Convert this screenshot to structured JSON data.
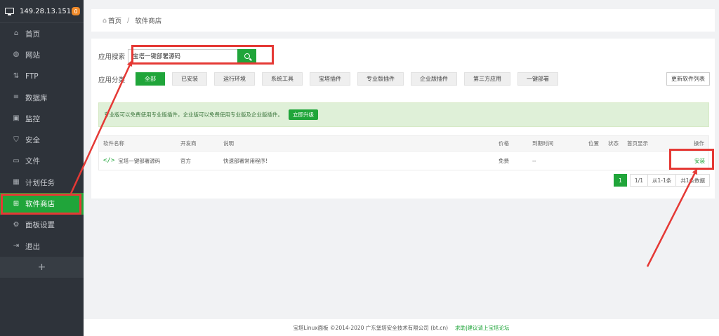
{
  "sidebar": {
    "server_ip": "149.28.13.151",
    "badge_count": "0",
    "items": [
      {
        "label": "首页",
        "icon": "home-icon"
      },
      {
        "label": "网站",
        "icon": "globe-icon"
      },
      {
        "label": "FTP",
        "icon": "ftp-icon"
      },
      {
        "label": "数据库",
        "icon": "database-icon"
      },
      {
        "label": "监控",
        "icon": "monitor-icon"
      },
      {
        "label": "安全",
        "icon": "shield-icon"
      },
      {
        "label": "文件",
        "icon": "folder-icon"
      },
      {
        "label": "计划任务",
        "icon": "calendar-icon"
      },
      {
        "label": "软件商店",
        "icon": "grid-icon",
        "active": true
      },
      {
        "label": "面板设置",
        "icon": "gear-icon"
      },
      {
        "label": "退出",
        "icon": "logout-icon"
      }
    ],
    "add_label": "+"
  },
  "breadcrumb": {
    "home": "首页",
    "separator": "/",
    "current": "软件商店"
  },
  "search": {
    "label": "应用搜索",
    "value": "宝塔一键部署源码"
  },
  "categories": {
    "label": "应用分类",
    "items": [
      "全部",
      "已安装",
      "运行环境",
      "系统工具",
      "宝塔插件",
      "专业版插件",
      "企业版插件",
      "第三方应用",
      "一键部署"
    ],
    "refresh_label": "更新软件列表"
  },
  "alert": {
    "text": "专业版可以免费使用专业版插件，企业版可以免费使用专业版及企业版插件。",
    "upgrade_label": "立即升级"
  },
  "table": {
    "headers": {
      "name": "软件名称",
      "developer": "开发商",
      "desc": "说明",
      "price": "价格",
      "expire": "到期时间",
      "position": "位置",
      "status": "状态",
      "homepage": "首页显示",
      "action": "操作"
    },
    "rows": [
      {
        "name": "宝塔一键部署源码",
        "developer": "官方",
        "desc": "快速部署常用程序!",
        "price": "免费",
        "expire": "--",
        "action": "安装"
      }
    ]
  },
  "pagination": {
    "current": "1",
    "pages": "1/1",
    "range": "从1-1条",
    "total": "共1条数据"
  },
  "footer": {
    "copyright": "宝塔Linux面板 ©2014-2020 广东堡塔安全技术有限公司 (bt.cn)",
    "help": "求助|建议请上宝塔论坛"
  },
  "colors": {
    "accent": "#20a53a",
    "sidebar_bg": "#2e333a",
    "annotation": "#e53935"
  }
}
